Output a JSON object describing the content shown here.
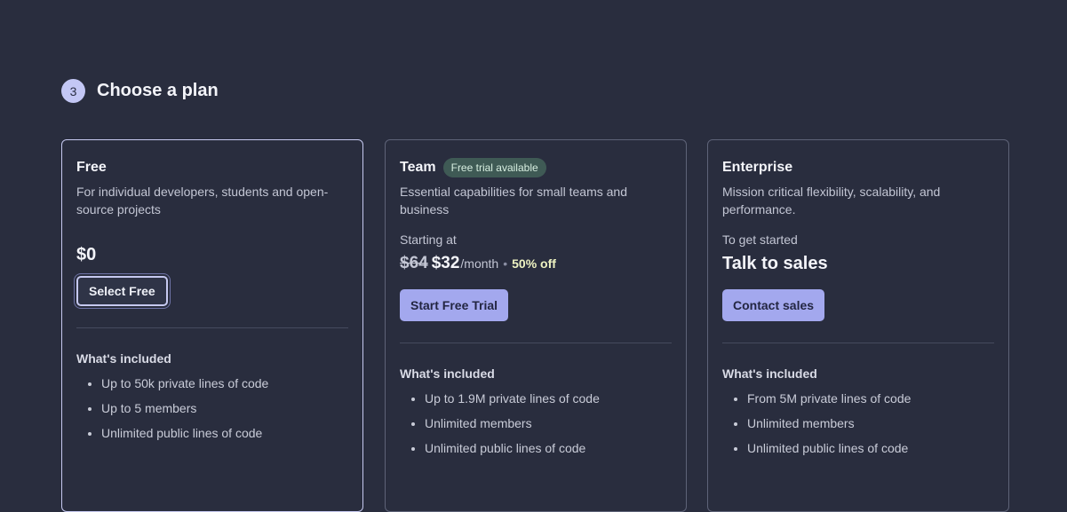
{
  "section": {
    "step": "3",
    "title": "Choose a plan"
  },
  "plans": [
    {
      "title": "Free",
      "description": "For individual developers, students and open-source projects",
      "price": "$0",
      "button": "Select Free",
      "included_title": "What's included",
      "features": [
        "Up to 50k private lines of code",
        "Up to 5 members",
        "Unlimited public lines of code"
      ]
    },
    {
      "title": "Team",
      "badge": "Free trial available",
      "description": "Essential capabilities for small teams and business",
      "price_caption": "Starting at",
      "old_price": "$64",
      "new_price": "$32",
      "period": "/month",
      "separator": "•",
      "discount": "50% off",
      "button": "Start Free Trial",
      "included_title": "What's included",
      "features": [
        "Up to 1.9M private lines of code",
        "Unlimited members",
        "Unlimited public lines of code"
      ]
    },
    {
      "title": "Enterprise",
      "description": "Mission critical flexibility, scalability, and performance.",
      "price_caption": "To get started",
      "price_value": "Talk to sales",
      "button": "Contact sales",
      "included_title": "What's included",
      "features": [
        "From 5M private lines of code",
        "Unlimited members",
        "Unlimited public lines of code"
      ]
    }
  ],
  "colors": {
    "background": "#292d3e",
    "accent": "#a3a8ee",
    "badge_bg": "#3f5a55",
    "discount": "#eef3c2"
  }
}
